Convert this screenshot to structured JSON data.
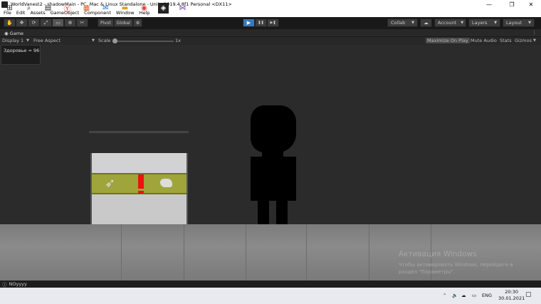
{
  "window": {
    "title": "WorldVanest2 - shadowMain - PC, Mac & Linux Standalone - Unity 2019.4.8f1 Personal <DX11>",
    "minimize": "—",
    "restore": "❐",
    "close": "✕"
  },
  "menu": [
    "File",
    "Edit",
    "Assets",
    "GameObject",
    "Component",
    "Window",
    "Help"
  ],
  "toolbar": {
    "tools": [
      "✋",
      "✥",
      "⟳",
      "⤢",
      "▭",
      "⊕",
      "✂"
    ],
    "pivot_label": "Pivot",
    "global_label": "Global",
    "extra_icon": "⚙",
    "play_icon": "▶",
    "pause_icon": "❚❚",
    "step_icon": "▶❚",
    "collab_label": "Collab",
    "account_label": "Account",
    "layers_label": "Layers",
    "layout_label": "Layout"
  },
  "game_tab": {
    "label": "Game",
    "display": "Display 1",
    "aspect": "Free Aspect",
    "scale_label": "Scale",
    "scale_value": "1x",
    "maximize_label": "Maximize On Play",
    "mute_label": "Mute Audio",
    "stats_label": "Stats",
    "gizmos_label": "Gizmos"
  },
  "game": {
    "health_text": "Здоровье = 96"
  },
  "activation": {
    "title": "Активация Windows",
    "line1": "Чтобы активировать Windows, перейдите в",
    "line2": "раздел \"Параметры\"."
  },
  "status": {
    "message": "NOyyyy"
  },
  "taskbar": {
    "lang": "ENG",
    "time": "20:30",
    "date": "30.01.2021"
  },
  "colors": {
    "play_active": "#3a79bb",
    "chest_band": "#9fa53a",
    "chest_lock": "#e11111"
  }
}
